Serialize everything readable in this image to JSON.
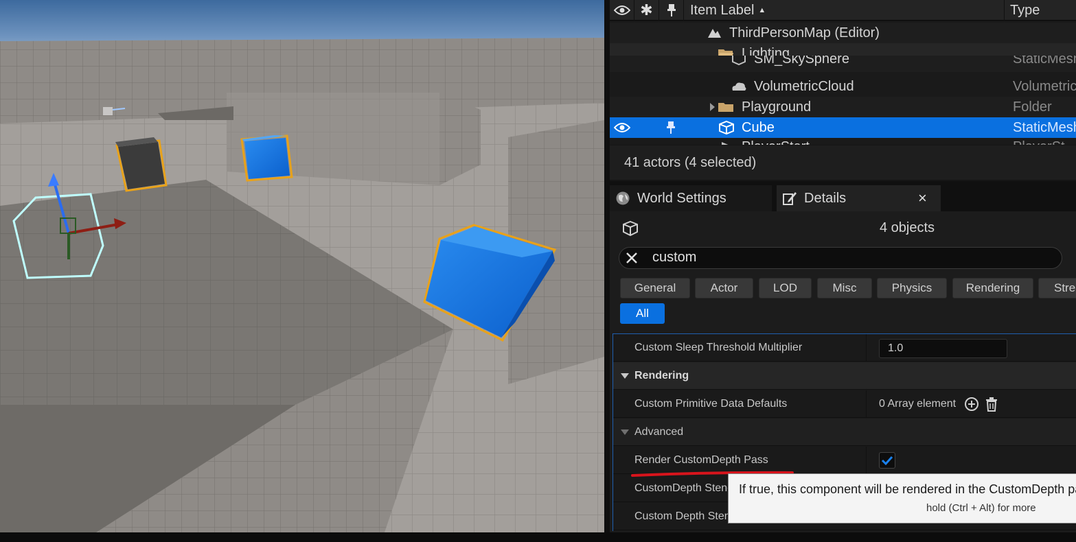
{
  "outliner": {
    "header": {
      "item_label": "Item Label",
      "sort_indicator": "▲",
      "type": "Type"
    },
    "rows": [
      {
        "label": "ThirdPersonMap (Editor)",
        "icon": "map-icon",
        "type": ""
      },
      {
        "label": "Lighting",
        "icon": "folder-open-icon",
        "type": ""
      },
      {
        "label": "SM_SkySphere",
        "icon": "static-mesh-icon",
        "type": "StaticMesh"
      },
      {
        "label": "VolumetricCloud",
        "icon": "volumetric-cloud-icon",
        "type": "Volumetric"
      },
      {
        "label": "Playground",
        "icon": "folder-icon",
        "type": "Folder"
      },
      {
        "label": "Cube",
        "icon": "static-mesh-icon",
        "type": "StaticMesh"
      },
      {
        "label": "PlayerStart",
        "icon": "player-start-icon",
        "type": "PlayerSt"
      }
    ],
    "actor_count": "41 actors (4 selected)"
  },
  "tabs": {
    "world_settings": "World Settings",
    "details": "Details",
    "close": "×"
  },
  "details": {
    "object_count": "4 objects",
    "search_value": "custom",
    "filters": [
      "General",
      "Actor",
      "LOD",
      "Misc",
      "Physics",
      "Rendering",
      "Streaming"
    ],
    "filter_all": "All",
    "properties": {
      "sleep_threshold_label": "Custom Sleep Threshold Multiplier",
      "sleep_threshold_value": "1.0",
      "rendering_category": "Rendering",
      "primitive_data_label": "Custom Primitive Data Defaults",
      "primitive_data_value": "0 Array element",
      "advanced_label": "Advanced",
      "render_custom_depth_label": "Render CustomDepth Pass",
      "render_custom_depth_checked": true,
      "stencil_value_label": "CustomDepth Stencil Value",
      "stencil_write_mask_label": "Custom Depth Stencil Write Mask"
    },
    "tooltip": {
      "text": "If true, this component will be rendered in the CustomDepth pass",
      "hint": "hold (Ctrl + Alt) for more"
    }
  },
  "colors": {
    "selection_blue": "#0a70e0",
    "cube_blue": "#1a7ae0",
    "annotation_red": "#d8141c"
  }
}
